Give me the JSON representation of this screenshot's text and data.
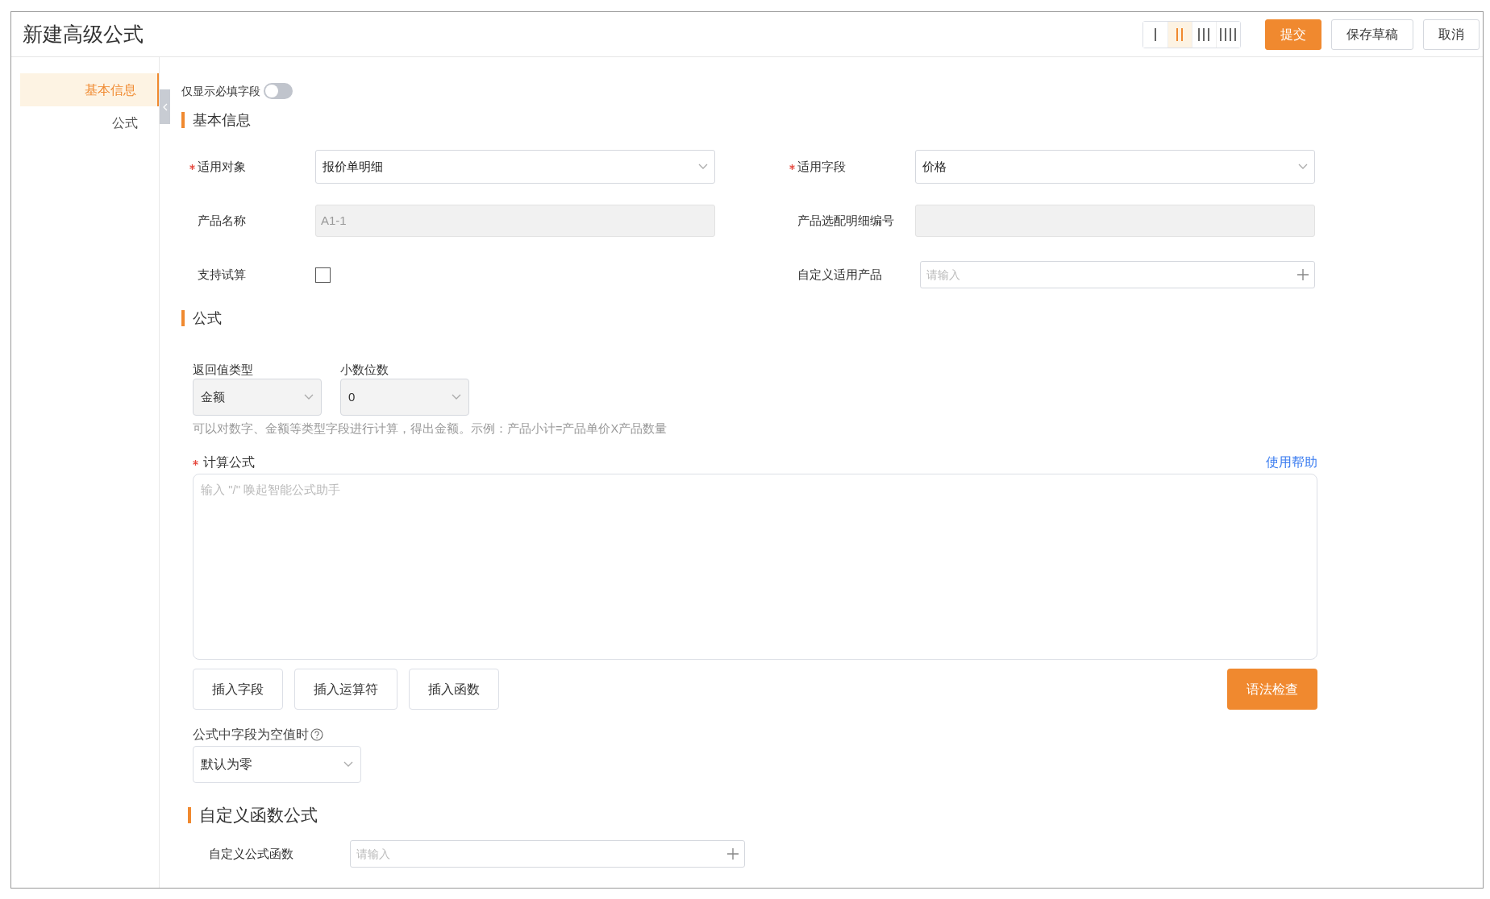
{
  "header": {
    "title": "新建高级公式",
    "layout_options": [
      {
        "selected": false
      },
      {
        "selected": true
      },
      {
        "selected": false
      },
      {
        "selected": false
      }
    ],
    "buttons": [
      {
        "label": "提交",
        "kind": "primary"
      },
      {
        "label": "保存草稿",
        "kind": "default"
      },
      {
        "label": "取消",
        "kind": "default"
      }
    ]
  },
  "sidebar": {
    "items": [
      {
        "label": "基本信息",
        "selected": true
      },
      {
        "label": "公式",
        "selected": false
      }
    ]
  },
  "required_only_toggle": {
    "label": "仅显示必填字段",
    "on": false
  },
  "basic_info": {
    "title": "基本信息",
    "fields": [
      {
        "kind": "select",
        "label": "适用对象",
        "required": true,
        "value": "报价单明细"
      },
      {
        "kind": "select",
        "label": "适用字段",
        "required": true,
        "value": "价格"
      },
      {
        "kind": "readonly",
        "label": "产品名称",
        "required": false,
        "value": "A1-1"
      },
      {
        "kind": "readonly",
        "label": "产品选配明细编号",
        "required": false
      },
      {
        "kind": "checkbox",
        "label": "支持试算",
        "required": false,
        "checked": false
      },
      {
        "kind": "picker",
        "label": "自定义适用产品",
        "required": false,
        "placeholder": "请输入"
      }
    ]
  },
  "formula": {
    "title": "公式",
    "return_type": {
      "label": "返回值类型",
      "value": "金额"
    },
    "decimals": {
      "label": "小数位数",
      "value": "0"
    },
    "hint": "可以对数字、金额等类型字段进行计算，得出金额。示例：产品小计=产品单价X产品数量",
    "expression": {
      "label": "计算公式",
      "required": true,
      "help_link": "使用帮助",
      "placeholder": "输入 \"/\" 唤起智能公式助手"
    },
    "insert_buttons": [
      "插入字段",
      "插入运算符",
      "插入函数"
    ],
    "check_button": "语法检查",
    "null_handling": {
      "label": "公式中字段为空值时",
      "value": "默认为零"
    }
  },
  "custom_functions": {
    "title": "自定义函数公式",
    "field": {
      "label": "自定义公式函数",
      "placeholder": "请输入"
    }
  }
}
